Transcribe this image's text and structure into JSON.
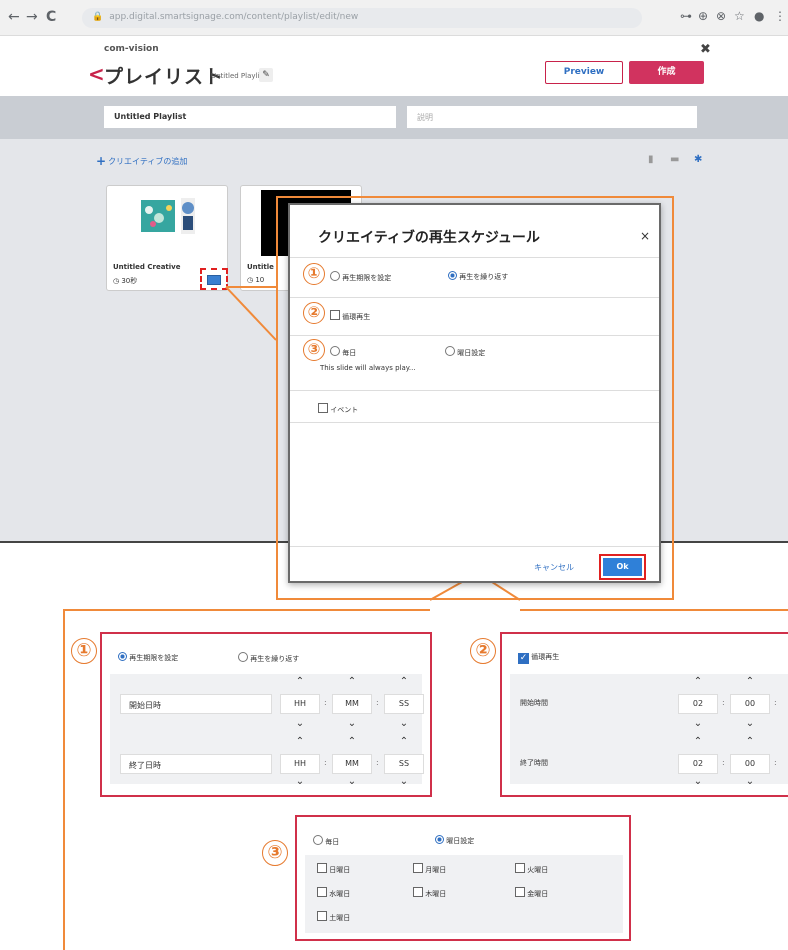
{
  "browser": {
    "back": "←",
    "forward": "→",
    "reload": "C",
    "url": "app.digital.smartsignage.com/content/playlist/edit/new"
  },
  "app": {
    "logo": "com-vision",
    "close": "✖",
    "back_icon": "<",
    "title": "プレイリスト",
    "subtitle": "Untitled Playlist *",
    "edit_icon": "✎",
    "preview_label": "Preview",
    "create_label": "作成",
    "name_value": "Untitled Playlist",
    "desc_placeholder": "説明",
    "add_creative_icon": "+",
    "add_creative_label": "クリエイティブの追加"
  },
  "cards": [
    {
      "name": "Untitled Creative",
      "duration": "30秒"
    },
    {
      "name": "Untitle",
      "duration": "10"
    }
  ],
  "modal": {
    "title": "クリエイティブの再生スケジュール",
    "close": "×",
    "opt_period": "再生期限を設定",
    "opt_repeat": "再生を繰り返す",
    "loop": "循環再生",
    "daily": "毎日",
    "weekday": "曜日設定",
    "daily_note": "This slide will always play...",
    "event": "イベント",
    "cancel_label": "キャンセル",
    "ok_label": "Ok"
  },
  "panel1": {
    "opt_period": "再生期限を設定",
    "opt_repeat": "再生を繰り返す",
    "start_label": "開始日時",
    "end_label": "終了日時",
    "hh": "HH",
    "mm": "MM",
    "ss": "SS"
  },
  "panel2": {
    "loop": "循環再生",
    "start_label": "開始時間",
    "end_label": "終了時間",
    "h": "02",
    "m": "00"
  },
  "panel3": {
    "daily": "毎日",
    "weekday": "曜日設定",
    "days": [
      "日曜日",
      "月曜日",
      "火曜日",
      "水曜日",
      "木曜日",
      "金曜日",
      "土曜日"
    ]
  },
  "markers": [
    "①",
    "②",
    "③"
  ]
}
